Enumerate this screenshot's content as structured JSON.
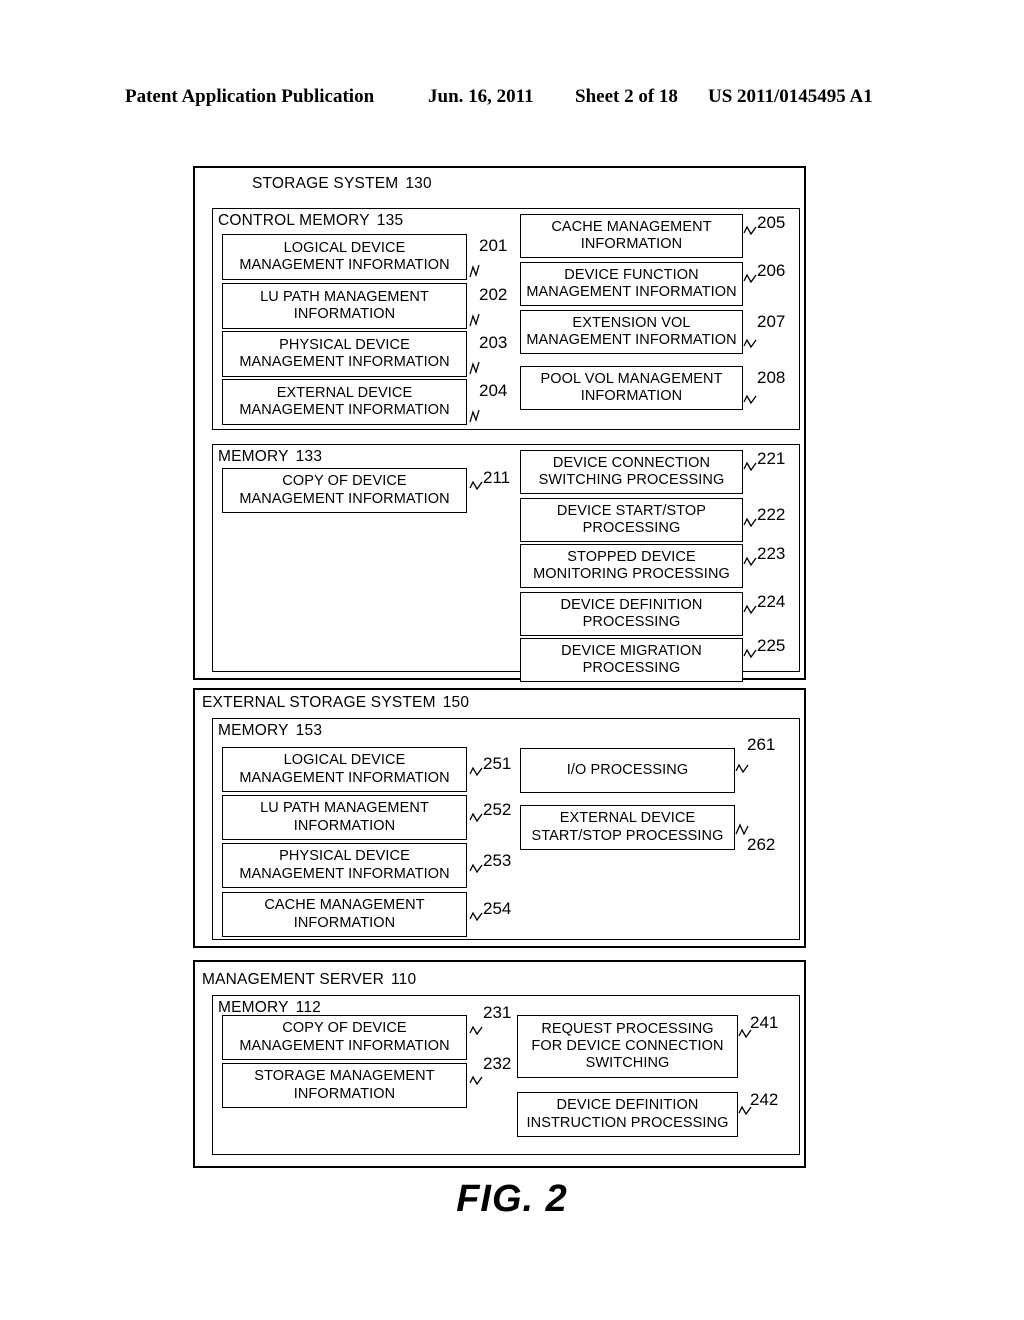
{
  "header": {
    "title": "Patent Application Publication",
    "date": "Jun. 16, 2011",
    "sheet": "Sheet 2 of 18",
    "pub_number": "US 2011/0145495 A1"
  },
  "figure": {
    "caption": "FIG. 2"
  },
  "sections": [
    {
      "id": "storage-system",
      "title": "STORAGE SYSTEM",
      "number": "130",
      "panels": [
        {
          "id": "control-memory",
          "title": "CONTROL MEMORY",
          "number": "135",
          "left_blocks": [
            {
              "lines": [
                "LOGICAL DEVICE",
                "MANAGEMENT INFORMATION"
              ],
              "ref": "201"
            },
            {
              "lines": [
                "LU PATH MANAGEMENT",
                "INFORMATION"
              ],
              "ref": "202"
            },
            {
              "lines": [
                "PHYSICAL DEVICE",
                "MANAGEMENT INFORMATION"
              ],
              "ref": "203"
            },
            {
              "lines": [
                "EXTERNAL DEVICE",
                "MANAGEMENT INFORMATION"
              ],
              "ref": "204"
            }
          ],
          "right_blocks": [
            {
              "lines": [
                "CACHE MANAGEMENT",
                "INFORMATION"
              ],
              "ref": "205"
            },
            {
              "lines": [
                "DEVICE FUNCTION",
                "MANAGEMENT INFORMATION"
              ],
              "ref": "206"
            },
            {
              "lines": [
                "EXTENSION VOL",
                "MANAGEMENT INFORMATION"
              ],
              "ref": "207"
            },
            {
              "lines": [
                "POOL VOL MANAGEMENT",
                "INFORMATION"
              ],
              "ref": "208"
            }
          ]
        },
        {
          "id": "memory-133",
          "title": "MEMORY",
          "number": "133",
          "left_blocks": [
            {
              "lines": [
                "COPY OF DEVICE",
                "MANAGEMENT INFORMATION"
              ],
              "ref": "211"
            }
          ],
          "right_blocks": [
            {
              "lines": [
                "DEVICE CONNECTION",
                "SWITCHING PROCESSING"
              ],
              "ref": "221"
            },
            {
              "lines": [
                "DEVICE START/STOP",
                "PROCESSING"
              ],
              "ref": "222"
            },
            {
              "lines": [
                "STOPPED DEVICE",
                "MONITORING PROCESSING"
              ],
              "ref": "223"
            },
            {
              "lines": [
                "DEVICE DEFINITION",
                "PROCESSING"
              ],
              "ref": "224"
            },
            {
              "lines": [
                "DEVICE MIGRATION",
                "PROCESSING"
              ],
              "ref": "225"
            }
          ]
        }
      ]
    },
    {
      "id": "external-storage-system",
      "title": "EXTERNAL STORAGE SYSTEM",
      "number": "150",
      "panels": [
        {
          "id": "memory-153",
          "title": "MEMORY",
          "number": "153",
          "left_blocks": [
            {
              "lines": [
                "LOGICAL DEVICE",
                "MANAGEMENT INFORMATION"
              ],
              "ref": "251"
            },
            {
              "lines": [
                "LU PATH MANAGEMENT",
                "INFORMATION"
              ],
              "ref": "252"
            },
            {
              "lines": [
                "PHYSICAL DEVICE",
                "MANAGEMENT INFORMATION"
              ],
              "ref": "253"
            },
            {
              "lines": [
                "CACHE MANAGEMENT",
                "INFORMATION"
              ],
              "ref": "254"
            }
          ],
          "right_blocks": [
            {
              "lines": [
                "I/O PROCESSING"
              ],
              "ref": "261"
            },
            {
              "lines": [
                "EXTERNAL DEVICE",
                "START/STOP PROCESSING"
              ],
              "ref": "262"
            }
          ]
        }
      ]
    },
    {
      "id": "management-server",
      "title": "MANAGEMENT SERVER",
      "number": "110",
      "panels": [
        {
          "id": "memory-112",
          "title": "MEMORY",
          "number": "112",
          "left_blocks": [
            {
              "lines": [
                "COPY OF DEVICE",
                "MANAGEMENT INFORMATION"
              ],
              "ref": "231"
            },
            {
              "lines": [
                "STORAGE MANAGEMENT",
                "INFORMATION"
              ],
              "ref": "232"
            }
          ],
          "right_blocks": [
            {
              "lines": [
                "REQUEST PROCESSING",
                "FOR DEVICE CONNECTION",
                "SWITCHING"
              ],
              "ref": "241"
            },
            {
              "lines": [
                "DEVICE DEFINITION",
                "INSTRUCTION PROCESSING"
              ],
              "ref": "242"
            }
          ]
        }
      ]
    }
  ]
}
